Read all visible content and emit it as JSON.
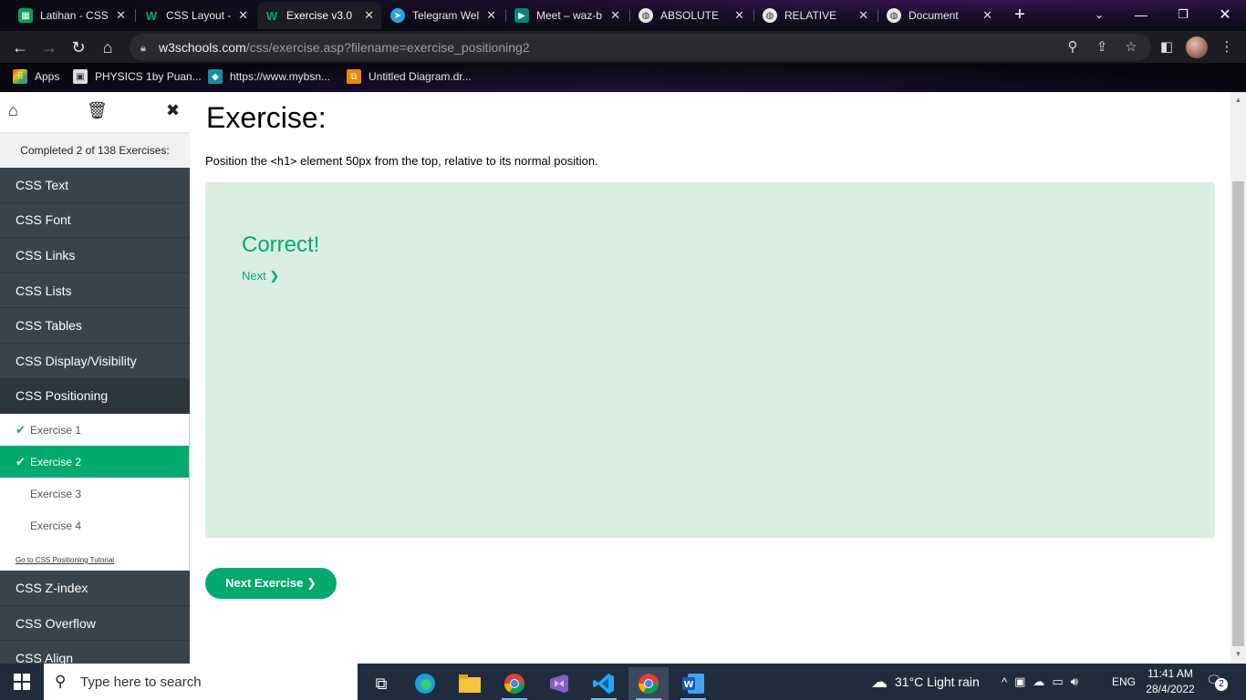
{
  "browser": {
    "tabs": [
      {
        "title": "Latihan - CSS",
        "icon": "sheets-icon",
        "color": "#0f9d58"
      },
      {
        "title": "CSS Layout -",
        "icon": "w3schools-icon",
        "color": "#04aa6d"
      },
      {
        "title": "Exercise v3.0",
        "icon": "w3schools-icon",
        "color": "#04aa6d"
      },
      {
        "title": "Telegram Wel",
        "icon": "telegram-icon",
        "color": "#2aa3de"
      },
      {
        "title": "Meet – waz-b",
        "icon": "meet-icon",
        "color": "#00897b"
      },
      {
        "title": "ABSOLUTE",
        "icon": "globe-icon",
        "color": "#e8e8e8"
      },
      {
        "title": "RELATIVE",
        "icon": "globe-icon",
        "color": "#e8e8e8"
      },
      {
        "title": "Document",
        "icon": "globe-icon",
        "color": "#e8e8e8"
      }
    ],
    "url_host": "w3schools.com",
    "url_path": "/css/exercise.asp?filename=exercise_positioning2",
    "bookmarks": [
      {
        "label": "Apps",
        "icon": "apps-grid-icon"
      },
      {
        "label": "PHYSICS 1by Puan...",
        "icon": "classroom-icon"
      },
      {
        "label": "https://www.mybsn...",
        "icon": "bsn-icon"
      },
      {
        "label": "Untitled Diagram.dr...",
        "icon": "drawio-icon"
      }
    ]
  },
  "sidebar": {
    "completed": "Completed 2 of 138 Exercises:",
    "topics_before": [
      "CSS Text",
      "CSS Font",
      "CSS Links",
      "CSS Lists",
      "CSS Tables",
      "CSS Display/Visibility"
    ],
    "open_topic": "CSS Positioning",
    "exercises": [
      {
        "label": "Exercise 1",
        "done": true
      },
      {
        "label": "Exercise 2",
        "done": true
      },
      {
        "label": "Exercise 3",
        "done": false
      },
      {
        "label": "Exercise 4",
        "done": false
      }
    ],
    "tutorial_link": "Go to CSS Positioning Tutorial",
    "topics_after": [
      "CSS Z-index",
      "CSS Overflow",
      "CSS Align"
    ]
  },
  "main": {
    "heading": "Exercise:",
    "instruction_pre": "Position the",
    "instruction_code": "<h1>",
    "instruction_post": "element 50px from the top, relative to its normal position.",
    "result": "Correct!",
    "next_link": "Next ❯",
    "next_button": "Next Exercise ❯"
  },
  "taskbar": {
    "search_placeholder": "Type here to search",
    "weather": "31°C  Light rain",
    "language": "ENG",
    "time": "11:41 AM",
    "date": "28/4/2022",
    "notifications": "2"
  },
  "colors": {
    "accent": "#04aa6d",
    "sidebar_topic": "#38444d",
    "result_bg": "#d9eee1"
  }
}
